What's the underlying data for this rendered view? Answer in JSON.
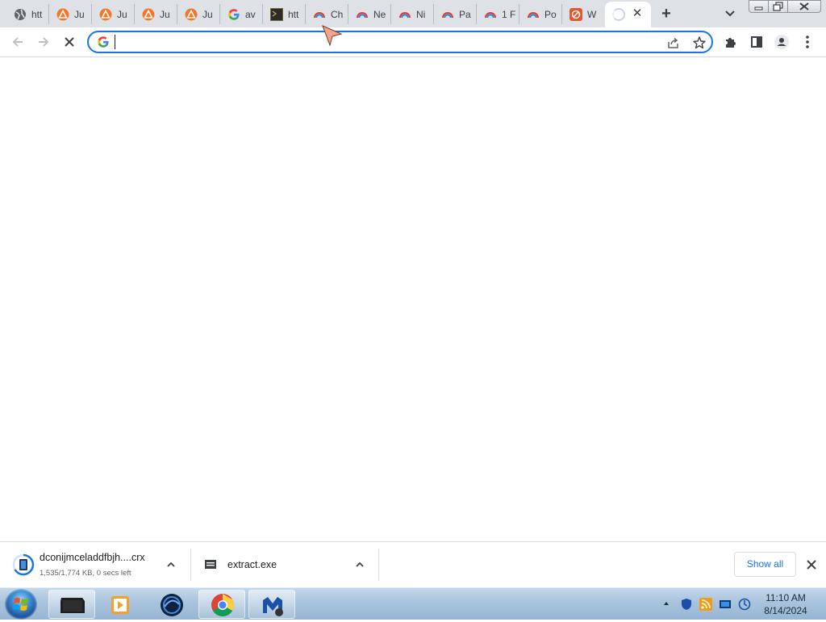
{
  "browser": {
    "tabs": [
      {
        "label": "htt",
        "icon": "globe-icon"
      },
      {
        "label": "Ju",
        "icon": "jupyter-alert-icon"
      },
      {
        "label": "Ju",
        "icon": "jupyter-alert-icon"
      },
      {
        "label": "Ju",
        "icon": "jupyter-alert-icon"
      },
      {
        "label": "Ju",
        "icon": "jupyter-alert-icon"
      },
      {
        "label": "av",
        "icon": "google-icon"
      },
      {
        "label": "htt",
        "icon": "terminal-favicon-icon"
      },
      {
        "label": "Ch",
        "icon": "rainbow-icon"
      },
      {
        "label": "Ne",
        "icon": "rainbow-icon"
      },
      {
        "label": "Ni",
        "icon": "rainbow-icon"
      },
      {
        "label": "Pa",
        "icon": "rainbow-icon"
      },
      {
        "label": "1 F",
        "icon": "rainbow-icon"
      },
      {
        "label": "Po",
        "icon": "rainbow-icon"
      },
      {
        "label": "W",
        "icon": "blocked-icon"
      }
    ],
    "active_tab": {
      "icon": "loading-spinner-icon",
      "close_label": "✕"
    },
    "new_tab_label": "+",
    "omnibox": {
      "value": "",
      "search_engine_icon": "google-icon"
    }
  },
  "downloads": [
    {
      "name": "dconijmceladdfbjh....crx",
      "status": "1,535/1,774 KB, 0 secs left",
      "icon": "crx-download-icon"
    },
    {
      "name": "extract.exe",
      "status": "",
      "icon": "exe-file-icon"
    }
  ],
  "shelf": {
    "show_all_label": "Show all"
  },
  "taskbar": {
    "time": "11:10 AM",
    "date": "8/14/2024",
    "apps": [
      "terminal-app-icon",
      "media-player-icon",
      "browser-globe-icon",
      "chrome-icon",
      "malwarebytes-icon"
    ]
  },
  "colors": {
    "accent": "#1a73e8",
    "tab_strip": "#dee1e6",
    "taskbar": "#a9c3dc"
  }
}
